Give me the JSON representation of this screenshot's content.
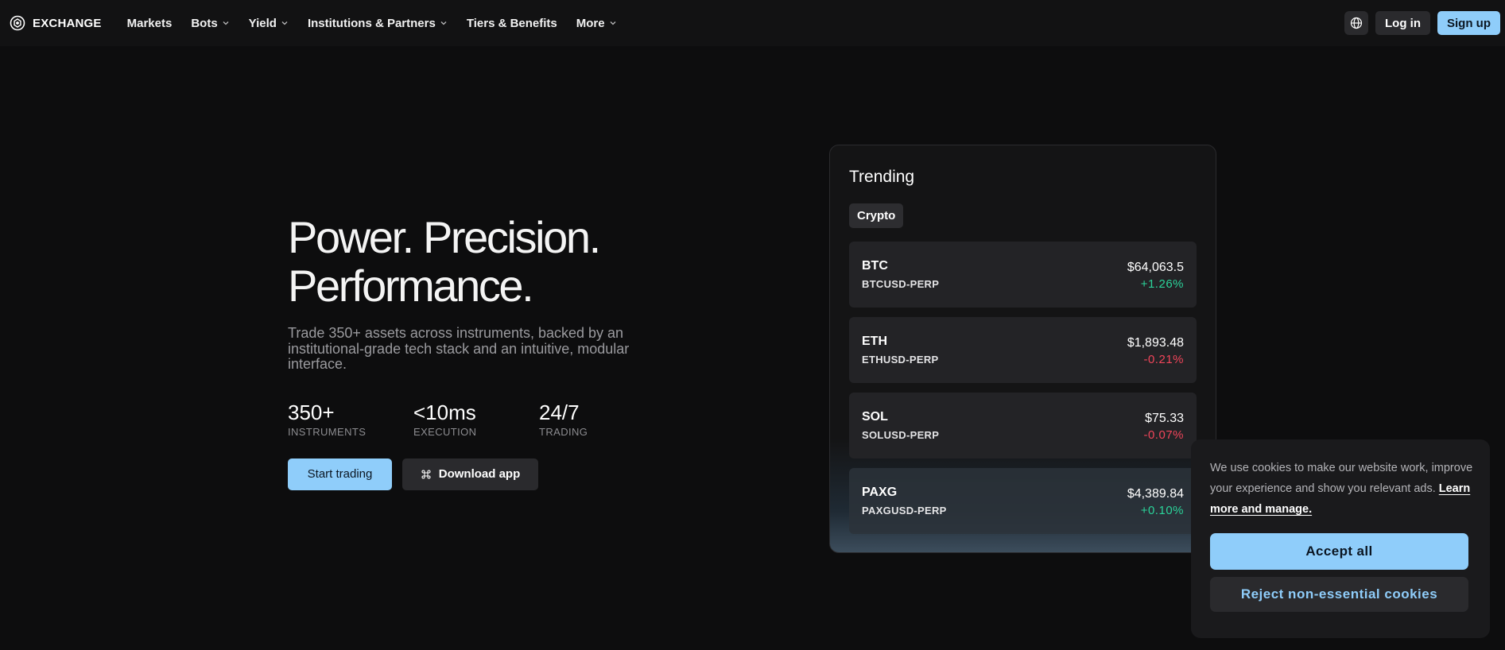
{
  "nav": {
    "brand": "EXCHANGE",
    "items": [
      {
        "label": "Markets",
        "dropdown": false
      },
      {
        "label": "Bots",
        "dropdown": true
      },
      {
        "label": "Yield",
        "dropdown": true
      },
      {
        "label": "Institutions & Partners",
        "dropdown": true
      },
      {
        "label": "Tiers & Benefits",
        "dropdown": false
      },
      {
        "label": "More",
        "dropdown": true
      }
    ],
    "login_label": "Log in",
    "signup_label": "Sign up"
  },
  "hero": {
    "title_line1": "Power. Precision.",
    "title_line2": "Performance.",
    "subtitle": "Trade 350+ assets across instruments, backed by an institutional-grade tech stack and an intuitive, modular interface.",
    "stats": [
      {
        "value": "350+",
        "label": "INSTRUMENTS"
      },
      {
        "value": "<10ms",
        "label": "EXECUTION"
      },
      {
        "value": "24/7",
        "label": "TRADING"
      }
    ],
    "start_label": "Start trading",
    "download_label": "Download app"
  },
  "trending": {
    "title": "Trending",
    "tab": "Crypto",
    "rows": [
      {
        "symbol": "BTC",
        "pair": "BTCUSD-PERP",
        "price": "$64,063.5",
        "change": "+1.26%",
        "direction": "up"
      },
      {
        "symbol": "ETH",
        "pair": "ETHUSD-PERP",
        "price": "$1,893.48",
        "change": "-0.21%",
        "direction": "down"
      },
      {
        "symbol": "SOL",
        "pair": "SOLUSD-PERP",
        "price": "$75.33",
        "change": "-0.07%",
        "direction": "down"
      },
      {
        "symbol": "PAXG",
        "pair": "PAXGUSD-PERP",
        "price": "$4,389.84",
        "change": "+0.10%",
        "direction": "up"
      }
    ]
  },
  "cookie": {
    "text": "We use cookies to make our website work, improve your experience and show you relevant ads.",
    "link": "Learn more and manage.",
    "accept_label": "Accept all",
    "reject_label": "Reject non-essential cookies"
  },
  "colors": {
    "accent": "#8fcdfa",
    "positive": "#2bd39a",
    "negative": "#f0455a",
    "background": "#0d0d0e"
  }
}
